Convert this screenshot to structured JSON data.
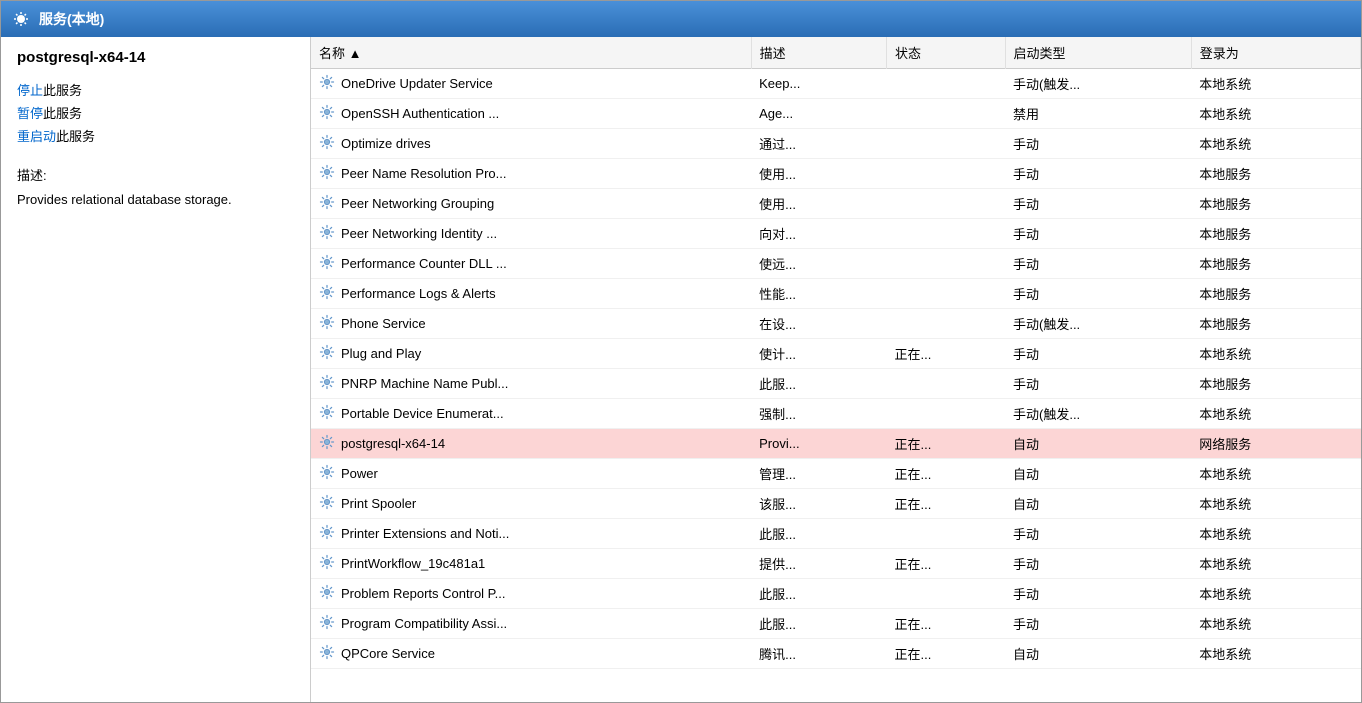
{
  "titleBar": {
    "icon": "gear",
    "title": "服务(本地)"
  },
  "leftPanel": {
    "serviceName": "postgresql-x64-14",
    "actions": [
      {
        "key": "stop",
        "prefix": "停止",
        "suffix": "此服务"
      },
      {
        "key": "pause",
        "prefix": "暂停",
        "suffix": "此服务"
      },
      {
        "key": "restart",
        "prefix": "重启动",
        "suffix": "此服务"
      }
    ],
    "descriptionLabel": "描述:",
    "descriptionText": "Provides relational database storage."
  },
  "table": {
    "headers": [
      "名称",
      "描述",
      "状态",
      "启动类型",
      "登录为"
    ],
    "sortIndicator": "▲",
    "rows": [
      {
        "name": "OneDrive Updater Service",
        "desc": "Keep...",
        "status": "",
        "startup": "手动(触发...",
        "login": "本地系统",
        "selected": false
      },
      {
        "name": "OpenSSH Authentication ...",
        "desc": "Age...",
        "status": "",
        "startup": "禁用",
        "login": "本地系统",
        "selected": false
      },
      {
        "name": "Optimize drives",
        "desc": "通过...",
        "status": "",
        "startup": "手动",
        "login": "本地系统",
        "selected": false
      },
      {
        "name": "Peer Name Resolution Pro...",
        "desc": "使用...",
        "status": "",
        "startup": "手动",
        "login": "本地服务",
        "selected": false
      },
      {
        "name": "Peer Networking Grouping",
        "desc": "使用...",
        "status": "",
        "startup": "手动",
        "login": "本地服务",
        "selected": false
      },
      {
        "name": "Peer Networking Identity ...",
        "desc": "向对...",
        "status": "",
        "startup": "手动",
        "login": "本地服务",
        "selected": false
      },
      {
        "name": "Performance Counter DLL ...",
        "desc": "使远...",
        "status": "",
        "startup": "手动",
        "login": "本地服务",
        "selected": false
      },
      {
        "name": "Performance Logs & Alerts",
        "desc": "性能...",
        "status": "",
        "startup": "手动",
        "login": "本地服务",
        "selected": false
      },
      {
        "name": "Phone Service",
        "desc": "在设...",
        "status": "",
        "startup": "手动(触发...",
        "login": "本地服务",
        "selected": false
      },
      {
        "name": "Plug and Play",
        "desc": "使计...",
        "status": "正在...",
        "startup": "手动",
        "login": "本地系统",
        "selected": false
      },
      {
        "name": "PNRP Machine Name Publ...",
        "desc": "此服...",
        "status": "",
        "startup": "手动",
        "login": "本地服务",
        "selected": false
      },
      {
        "name": "Portable Device Enumerat...",
        "desc": "强制...",
        "status": "",
        "startup": "手动(触发...",
        "login": "本地系统",
        "selected": false
      },
      {
        "name": "postgresql-x64-14",
        "desc": "Provi...",
        "status": "正在...",
        "startup": "自动",
        "login": "网络服务",
        "selected": true
      },
      {
        "name": "Power",
        "desc": "管理...",
        "status": "正在...",
        "startup": "自动",
        "login": "本地系统",
        "selected": false
      },
      {
        "name": "Print Spooler",
        "desc": "该服...",
        "status": "正在...",
        "startup": "自动",
        "login": "本地系统",
        "selected": false
      },
      {
        "name": "Printer Extensions and Noti...",
        "desc": "此服...",
        "status": "",
        "startup": "手动",
        "login": "本地系统",
        "selected": false
      },
      {
        "name": "PrintWorkflow_19c481a1",
        "desc": "提供...",
        "status": "正在...",
        "startup": "手动",
        "login": "本地系统",
        "selected": false
      },
      {
        "name": "Problem Reports Control P...",
        "desc": "此服...",
        "status": "",
        "startup": "手动",
        "login": "本地系统",
        "selected": false
      },
      {
        "name": "Program Compatibility Assi...",
        "desc": "此服...",
        "status": "正在...",
        "startup": "手动",
        "login": "本地系统",
        "selected": false
      },
      {
        "name": "QPCore Service",
        "desc": "腾讯...",
        "status": "正在...",
        "startup": "自动",
        "login": "本地系统",
        "selected": false
      }
    ]
  }
}
